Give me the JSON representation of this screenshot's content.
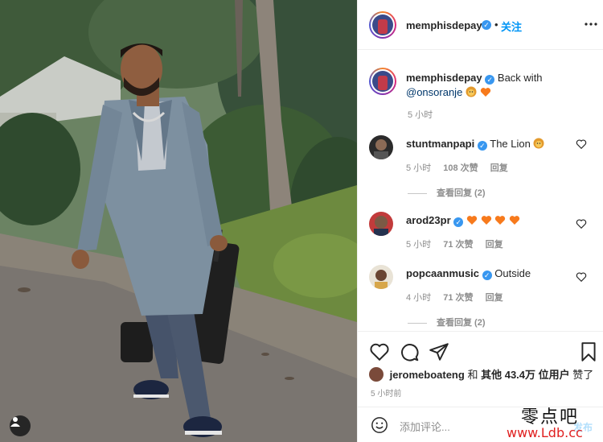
{
  "header": {
    "username": "memphisdepay",
    "separator": "•",
    "follow_label": "关注"
  },
  "caption": {
    "username": "memphisdepay",
    "text": "Back with",
    "mention": "@onsoranje",
    "time": "5 小时"
  },
  "comments": [
    {
      "username": "stuntmanpapi",
      "text": "The Lion",
      "time": "5 小时",
      "likes": "108 次赞",
      "reply_label": "回复",
      "view_replies": "查看回复 (2)"
    },
    {
      "username": "arod23pr",
      "text": "",
      "time": "5 小时",
      "likes": "71 次赞",
      "reply_label": "回复"
    },
    {
      "username": "popcaanmusic",
      "text": "Outside",
      "time": "4 小时",
      "likes": "71 次赞",
      "reply_label": "回复",
      "view_replies": "查看回复 (2)"
    }
  ],
  "likes": {
    "username": "jeromeboateng",
    "connector": "和",
    "others_label": "其他",
    "count": "43.4万",
    "unit": "位用户",
    "suffix": "赞了"
  },
  "post_time": "5 小时前",
  "add_comment": {
    "placeholder": "添加评论...",
    "post_label": "发布"
  },
  "watermark": {
    "top": "零点吧",
    "bottom": "www.Ldb.cc"
  },
  "colors": {
    "accent": "#0095f6",
    "verified": "#3897f0",
    "heart_orange": "#f77a1c"
  }
}
